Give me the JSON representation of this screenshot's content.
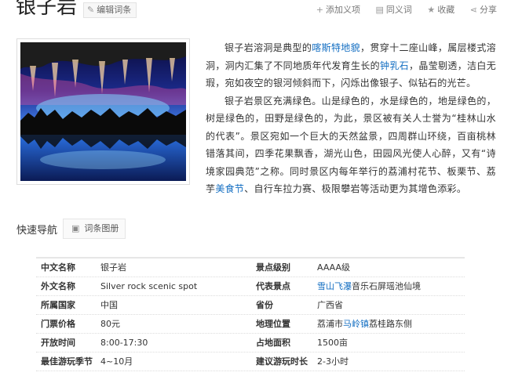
{
  "header": {
    "title": "银子岩",
    "edit_label": "编辑词条",
    "actions": [
      {
        "icon": "plus-icon",
        "label": "添加义项"
      },
      {
        "icon": "synonym-icon",
        "label": "同义词"
      },
      {
        "icon": "star-icon",
        "label": "收藏"
      },
      {
        "icon": "share-icon",
        "label": "分享"
      }
    ]
  },
  "intro": {
    "p1": [
      {
        "t": "银子岩溶洞是典型的"
      },
      {
        "t": "喀斯特地貌",
        "link": true
      },
      {
        "t": "，贯穿十二座山峰，属层楼式溶洞，洞内汇集了不同地质年代发育生长的"
      },
      {
        "t": "钟乳石",
        "link": true
      },
      {
        "t": "，晶莹剔透，洁白无瑕，宛如夜空的银河倾斜而下，闪烁出像银子、似钻石的光芒。"
      }
    ],
    "p2": [
      {
        "t": "银子岩景区充满绿色。山是绿色的，水是绿色的，地是绿色的，树是绿色的，田野是绿色的，为此，景区被有关人士誉为“桂林山水的代表”。景区宛如一个巨大的天然盆景，四周群山环绕，百亩桃林错落其间，四季花果飘香，湖光山色，田园风光使人心醉，又有“诗境家园典范”之称。同时景区内每年举行的荔浦村花节、板栗节、荔芋"
      },
      {
        "t": "美食节",
        "link": true
      },
      {
        "t": "、自行车拉力赛、极限攀岩等活动更为其增色添彩。"
      }
    ]
  },
  "nav": {
    "label": "快速导航",
    "album_label": "词条图册"
  },
  "info": [
    {
      "k1": "中文名称",
      "v1": [
        {
          "t": "银子岩"
        }
      ],
      "k2": "景点级别",
      "v2": [
        {
          "t": "AAAA级"
        }
      ]
    },
    {
      "k1": "外文名称",
      "v1": [
        {
          "t": "Silver rock scenic spot"
        }
      ],
      "k2": "代表景点",
      "v2": [
        {
          "t": "雪山飞瀑",
          "link": true
        },
        {
          "t": "音乐石屏瑶池仙境"
        }
      ]
    },
    {
      "k1": "所属国家",
      "v1": [
        {
          "t": "中国"
        }
      ],
      "k2": "省份",
      "v2": [
        {
          "t": "广西省"
        }
      ]
    },
    {
      "k1": "门票价格",
      "v1": [
        {
          "t": "80元"
        }
      ],
      "k2": "地理位置",
      "v2": [
        {
          "t": "荔浦市"
        },
        {
          "t": "马岭镇",
          "link": true
        },
        {
          "t": "荔桂路东侧"
        }
      ]
    },
    {
      "k1": "开放时间",
      "v1": [
        {
          "t": "8:00-17:30"
        }
      ],
      "k2": "占地面积",
      "v2": [
        {
          "t": "1500亩"
        }
      ]
    },
    {
      "k1": "最佳游玩季节",
      "v1": [
        {
          "t": "4~10月"
        }
      ],
      "k2": "建议游玩时长",
      "v2": [
        {
          "t": "2-3小时"
        }
      ]
    }
  ],
  "colors": {
    "link": "#136ec2",
    "border": "#e6e6e6"
  }
}
